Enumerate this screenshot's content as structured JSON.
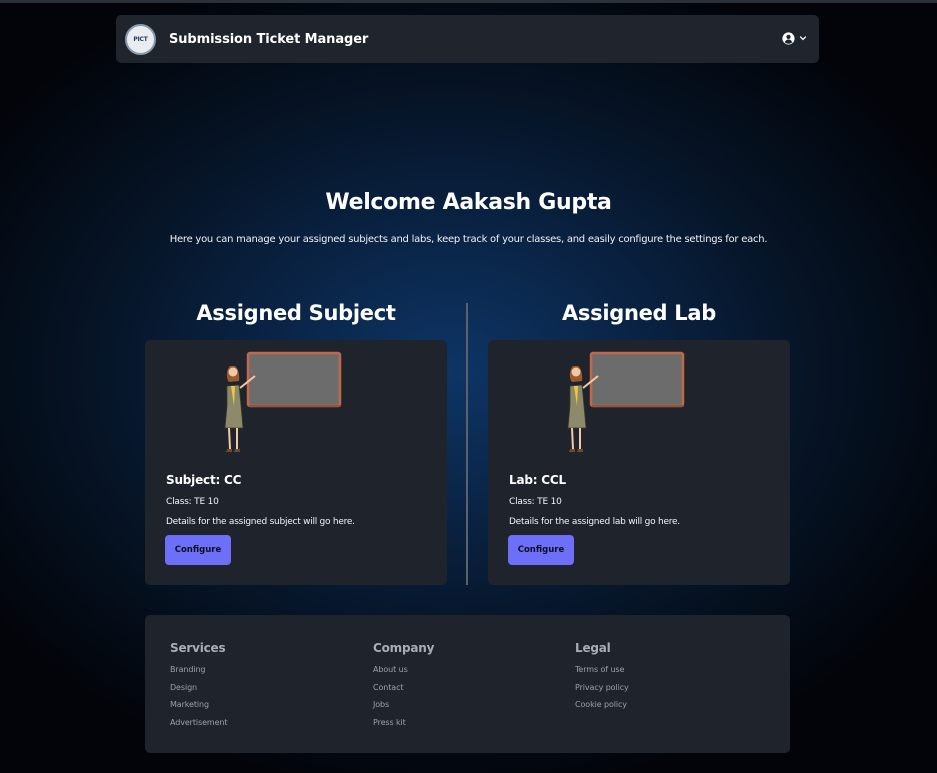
{
  "navbar": {
    "logo_text": "PICT",
    "title": "Submission Ticket Manager",
    "user_icon": "user-circle-icon",
    "dropdown_icon": "chevron-down-icon"
  },
  "hero": {
    "title": "Welcome Aakash Gupta",
    "subtitle": "Here you can manage your assigned subjects and labs, keep track of your classes, and easily configure the settings for each."
  },
  "subject_section": {
    "heading": "Assigned Subject",
    "card": {
      "illustration": "teacher-at-board-illustration",
      "title": "Subject: CC",
      "class_label": "Class: TE 10",
      "details": "Details for the assigned subject will go here.",
      "button_label": "Configure"
    }
  },
  "lab_section": {
    "heading": "Assigned Lab",
    "card": {
      "illustration": "teacher-at-board-illustration",
      "title": "Lab: CCL",
      "class_label": "Class: TE 10",
      "details": "Details for the assigned lab will go here.",
      "button_label": "Configure"
    }
  },
  "footer": {
    "columns": [
      {
        "heading": "Services",
        "links": [
          "Branding",
          "Design",
          "Marketing",
          "Advertisement"
        ]
      },
      {
        "heading": "Company",
        "links": [
          "About us",
          "Contact",
          "Jobs",
          "Press kit"
        ]
      },
      {
        "heading": "Legal",
        "links": [
          "Terms of use",
          "Privacy policy",
          "Cookie policy"
        ]
      }
    ]
  },
  "colors": {
    "accent_button": "#6d6ff8",
    "card_bg": "#1f232b",
    "navbar_bg": "#1f242d"
  }
}
